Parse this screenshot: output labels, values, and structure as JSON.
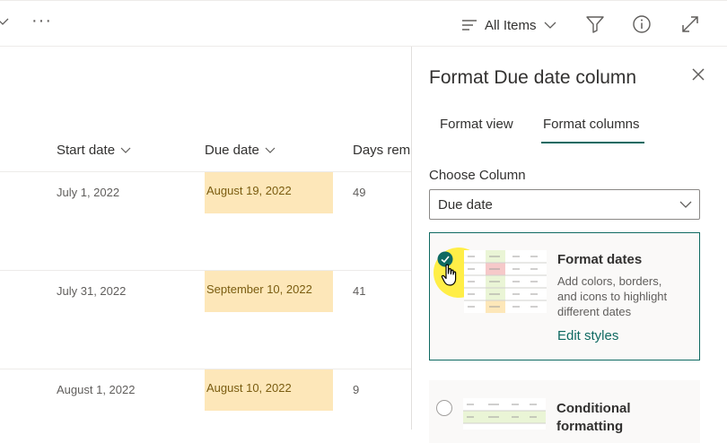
{
  "toolbar": {
    "more_label": "···",
    "view_label": "All Items"
  },
  "list": {
    "columns": [
      "Start date",
      "Due date",
      "Days rem"
    ],
    "rows": [
      {
        "start": "July 1, 2022",
        "due": "August 19, 2022",
        "days": "49"
      },
      {
        "start": "July 31, 2022",
        "due": "September 10, 2022",
        "days": "41"
      },
      {
        "start": "August 1, 2022",
        "due": "August 10, 2022",
        "days": "9"
      }
    ]
  },
  "panel": {
    "title": "Format Due date column",
    "tabs": [
      {
        "label": "Format view",
        "selected": false
      },
      {
        "label": "Format columns",
        "selected": true
      }
    ],
    "choose_label": "Choose Column",
    "column_value": "Due date",
    "options": [
      {
        "title": "Format dates",
        "description": "Add colors, borders, and icons to highlight different dates",
        "link": "Edit styles",
        "selected": true
      },
      {
        "title": "Conditional formatting",
        "selected": false
      }
    ]
  },
  "colors": {
    "accent": "#0f6a62",
    "due_highlight": "#fde7b9",
    "cursor_highlight": "#ffec28"
  }
}
